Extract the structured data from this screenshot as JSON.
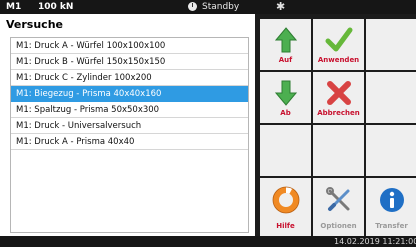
{
  "statusbar": {
    "machine": "M1",
    "force": "100 kN",
    "status": "Standby",
    "clock_icon": "clock-icon",
    "gear_icon": "gear-icon"
  },
  "panel": {
    "title": "Versuche",
    "items": [
      {
        "label": "M1: Druck A - Würfel 100x100x100",
        "selected": false
      },
      {
        "label": "M1: Druck B - Würfel 150x150x150",
        "selected": false
      },
      {
        "label": "M1: Druck C - Zylinder 100x200",
        "selected": false
      },
      {
        "label": "M1: Biegezug - Prisma 40x40x160",
        "selected": true
      },
      {
        "label": "M1: Spaltzug - Prisma 50x50x300",
        "selected": false
      },
      {
        "label": "M1: Druck - Universalversuch",
        "selected": false
      },
      {
        "label": "M1: Druck A - Prisma 40x40",
        "selected": false
      }
    ]
  },
  "buttons": {
    "up": {
      "label": "Auf",
      "icon": "arrow-up-icon"
    },
    "apply": {
      "label": "Anwenden",
      "icon": "checkmark-icon"
    },
    "down": {
      "label": "Ab",
      "icon": "arrow-down-icon"
    },
    "cancel": {
      "label": "Abbrechen",
      "icon": "cross-icon"
    },
    "help": {
      "label": "Hilfe",
      "icon": "lifebuoy-icon"
    },
    "options": {
      "label": "Optionen",
      "icon": "tools-icon"
    },
    "transfer": {
      "label": "Transfer",
      "icon": "info-icon"
    }
  },
  "footer": {
    "datetime": "14.02.2019 11:21:00"
  },
  "colors": {
    "selection": "#2f9be3",
    "accent_label": "#c8102e",
    "disabled_label": "#9a9a9a",
    "green": "#4caf50",
    "red": "#d84343",
    "info_blue": "#1f6fc5"
  }
}
